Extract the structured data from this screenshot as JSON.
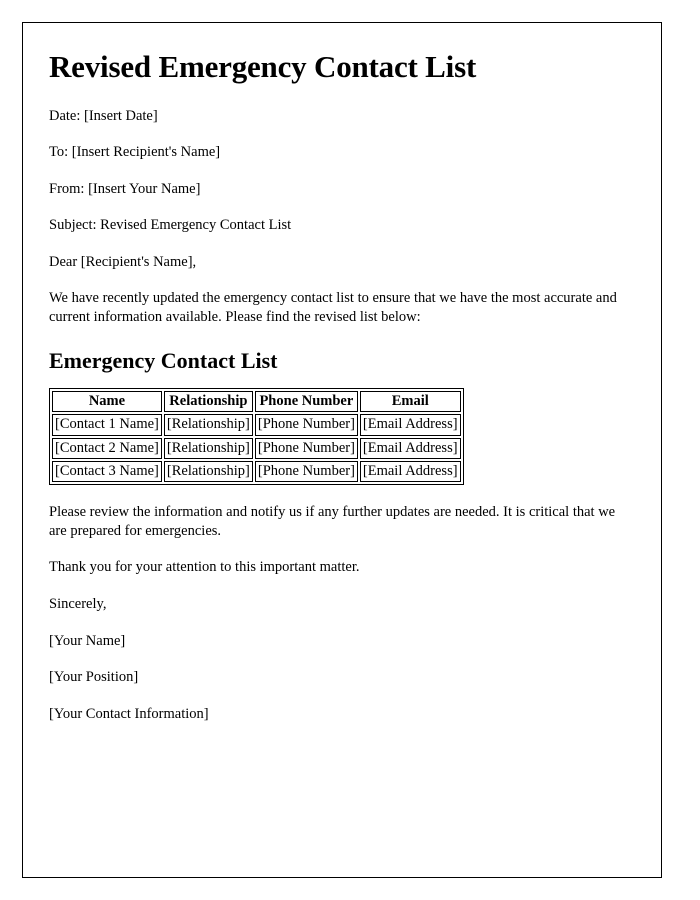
{
  "document": {
    "title": "Revised Emergency Contact List",
    "meta": [
      {
        "label": "Date",
        "text": "Date: [Insert Date]"
      },
      {
        "label": "To",
        "text": "To: [Insert Recipient's Name]"
      },
      {
        "label": "From",
        "text": "From: [Insert Your Name]"
      },
      {
        "label": "Subject",
        "text": "Subject: Revised Emergency Contact List"
      }
    ],
    "salutation": "Dear [Recipient's Name],",
    "intro_paragraph": "We have recently updated the emergency contact list to ensure that we have the most accurate and current information available. Please find the revised list below:",
    "section_heading": "Emergency Contact List",
    "table": {
      "columns": [
        "Name",
        "Relationship",
        "Phone Number",
        "Email"
      ],
      "rows": [
        [
          "[Contact 1 Name]",
          "[Relationship]",
          "[Phone Number]",
          "[Email Address]"
        ],
        [
          "[Contact 2 Name]",
          "[Relationship]",
          "[Phone Number]",
          "[Email Address]"
        ],
        [
          "[Contact 3 Name]",
          "[Relationship]",
          "[Phone Number]",
          "[Email Address]"
        ]
      ]
    },
    "closing_paragraph": "Please review the information and notify us if any further updates are needed. It is critical that we are prepared for emergencies.",
    "thanks_paragraph": "Thank you for your attention to this important matter.",
    "signoff": "Sincerely,",
    "signature_block": [
      "[Your Name]",
      "[Your Position]",
      "[Your Contact Information]"
    ]
  },
  "colors": {
    "text": "#000000",
    "page_background": "#ffffff",
    "border": "#000000"
  }
}
